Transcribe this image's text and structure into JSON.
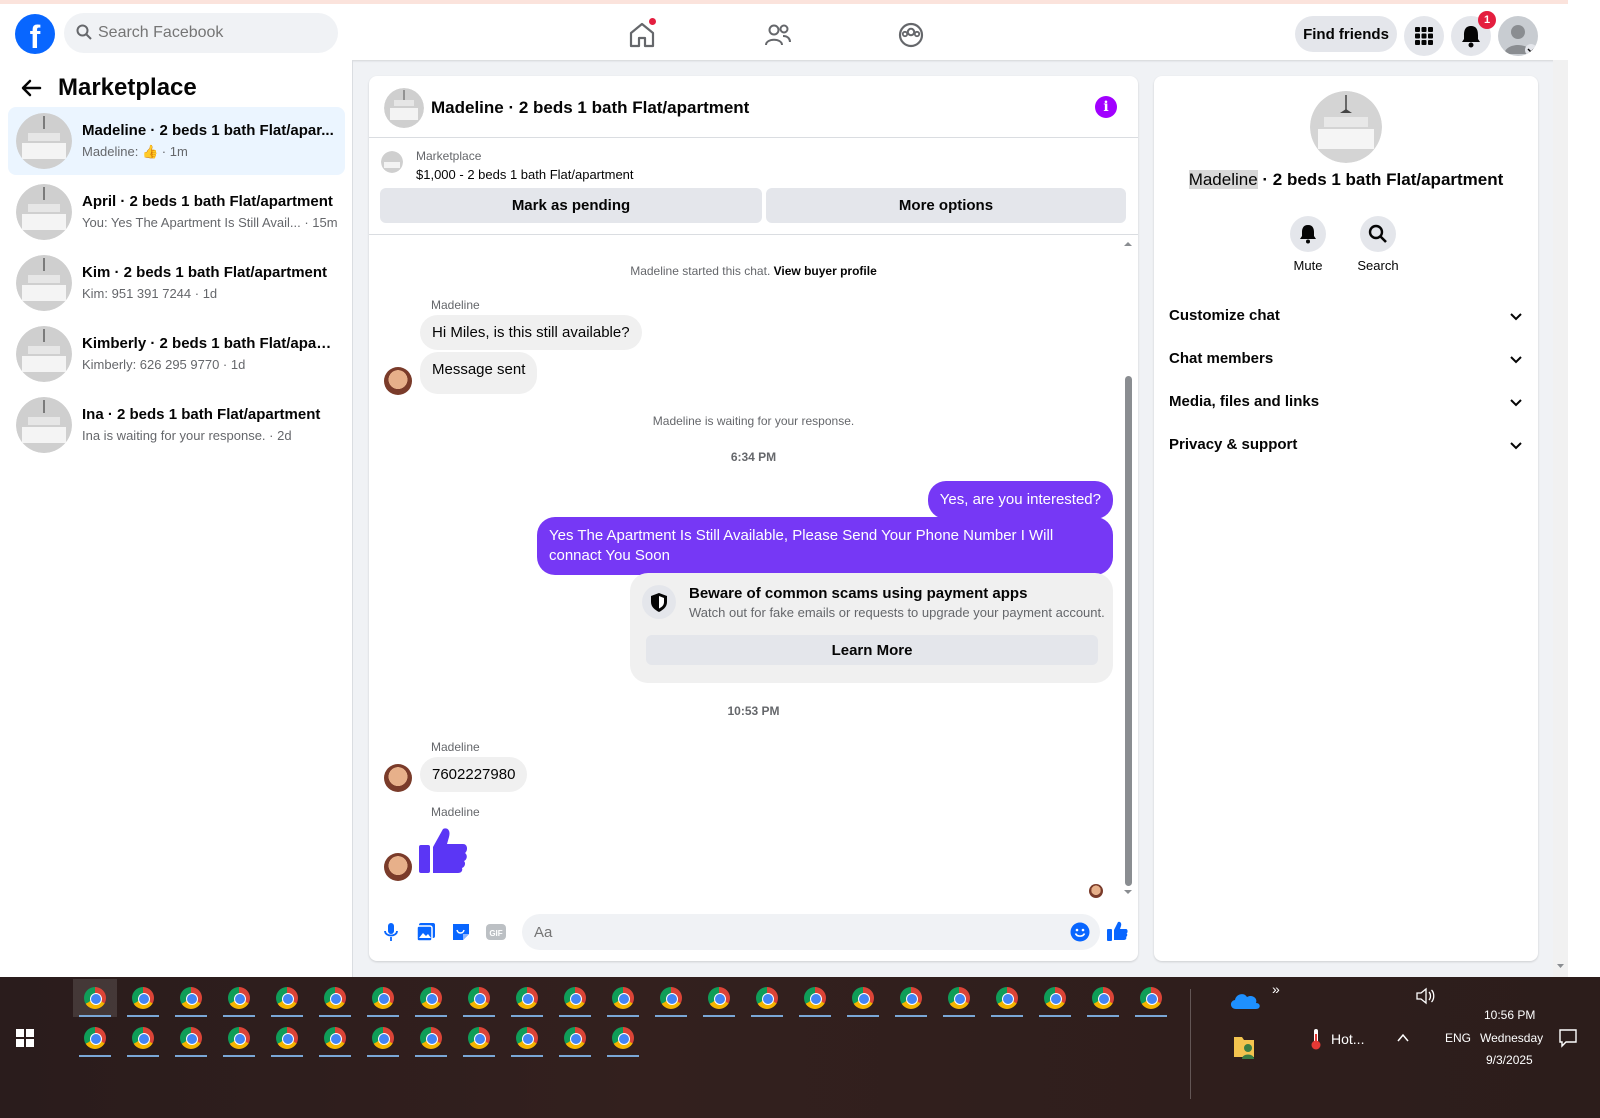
{
  "topbar": {
    "search_placeholder": "Search Facebook",
    "find_friends": "Find friends",
    "notification_count": "1"
  },
  "left": {
    "title": "Marketplace",
    "conversations": [
      {
        "title": "Madeline · 2 beds 1 bath Flat/apar...",
        "sub": "Madeline: 👍 · 1m",
        "active": true
      },
      {
        "title": "April · 2 beds 1 bath Flat/apartment",
        "sub": "You: Yes The Apartment Is Still Avail... · 15m"
      },
      {
        "title": "Kim · 2 beds 1 bath Flat/apartment",
        "sub": "Kim: 951 391 7244 · 1d"
      },
      {
        "title": "Kimberly · 2 beds 1 bath Flat/apart...",
        "sub": "Kimberly: 626 295 9770 · 1d"
      },
      {
        "title": "Ina · 2 beds 1 bath Flat/apartment",
        "sub": "Ina is waiting for your response. · 2d"
      }
    ]
  },
  "chat": {
    "title": "Madeline · 2 beds 1 bath Flat/apartment",
    "marketplace_label": "Marketplace",
    "listing": "$1,000 - 2 beds 1 bath Flat/apartment",
    "mark_pending": "Mark as pending",
    "more_options": "More options",
    "started": "Madeline started this chat.",
    "view_buyer": "View buyer profile",
    "sender": "Madeline",
    "msg1": "Hi Miles, is this still available?",
    "msg2": "Message sent",
    "waiting": "Madeline is waiting for your response.",
    "time1": "6:34 PM",
    "out1": "Yes, are you interested?",
    "out2": "Yes The Apartment Is Still Available, Please Send Your Phone Number I Will connact You Soon",
    "scam_title": "Beware of common scams using payment apps",
    "scam_desc": "Watch out for fake emails or requests to upgrade your payment account.",
    "learn_more": "Learn More",
    "time2": "10:53 PM",
    "msg3": "7602227980",
    "composer_placeholder": "Aa"
  },
  "right": {
    "title_name": "Madeline",
    "title_rest": " · 2 beds 1 bath Flat/apartment",
    "mute": "Mute",
    "search": "Search",
    "sections": [
      "Customize chat",
      "Chat members",
      "Media, files and links",
      "Privacy & support"
    ]
  },
  "taskbar": {
    "weather": "Hot...",
    "lang": "ENG",
    "time": "10:56 PM",
    "day": "Wednesday",
    "date": "9/3/2025"
  },
  "colors": {
    "accent": "#0866ff",
    "outgoing": "#7638f5",
    "info": "#a100ff"
  }
}
